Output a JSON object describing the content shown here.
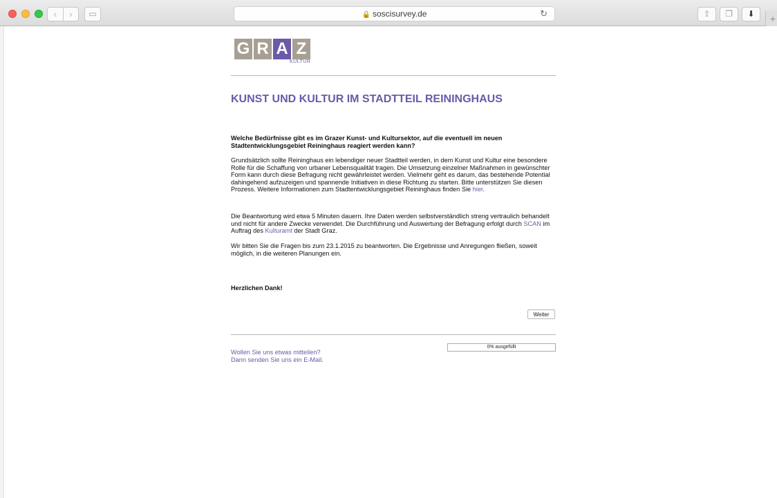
{
  "browser": {
    "url": "soscisurvey.de",
    "lock_glyph": "🔒",
    "reload_glyph": "↻",
    "back_glyph": "‹",
    "forward_glyph": "›",
    "sidebar_glyph": "▭",
    "share_glyph": "⇪",
    "tabs_glyph": "❐",
    "download_glyph": "⬇",
    "newtab_glyph": "+"
  },
  "logo": {
    "letters": [
      "G",
      "R",
      "A",
      "Z"
    ],
    "sub": "KULTUR",
    "colors": {
      "gray": "#a79f93",
      "accent": "#6a5aa7"
    }
  },
  "headline": "KUNST UND KULTUR IM STADTTEIL REININGHAUS",
  "intro_question": "Welche Bedürfnisse gibt es im Grazer Kunst- und Kultursektor, auf die eventuell im neuen Stadtentwicklungsgebiet Reininghaus reagiert werden kann?",
  "paragraph1": {
    "text": "Grundsätzlich sollte Reininghaus ein lebendiger neuer Stadtteil werden, in dem Kunst und Kultur eine besondere Rolle für die Schaffung von urbaner Lebensqualität tragen. Die Umsetzung einzelner Maßnahmen in gewünschter Form kann durch diese Befragung nicht gewährleistet werden. Vielmehr geht es darum, das bestehende Potential dahingehend aufzuzeigen und spannende Initiativen in diese Richtung zu starten. Bitte unterstützen Sie diesen Prozess. Weitere Informationen zum Stadtentwicklungsgebiet Reininghaus finden Sie ",
    "link": "hier",
    "end": "."
  },
  "paragraph2": {
    "text1": "Die Beantwortung wird etwa 5 Minuten dauern. Ihre Daten werden selbstverständlich streng vertraulich behandelt und nicht für andere Zwecke verwendet. Die Durchführung und Auswertung der Befragung erfolgt durch ",
    "link1": "SCAN",
    "text2": " im Auftrag des ",
    "link2": "Kulturamt",
    "text3": " der Stadt Graz."
  },
  "paragraph3": "Wir bitten Sie die Fragen bis zum 23.1.2015 zu beantworten. Die Ergebnisse und Anregungen fließen, soweit möglich, in die weiteren Planungen ein.",
  "thanks": "Herzlichen Dank!",
  "next_button": "Weiter",
  "progress": {
    "label": "0% ausgefüllt",
    "value": 0
  },
  "contact": {
    "line1": "Wollen Sie uns etwas mitteilen?",
    "line2": "Dann senden Sie uns ein E-Mail."
  }
}
